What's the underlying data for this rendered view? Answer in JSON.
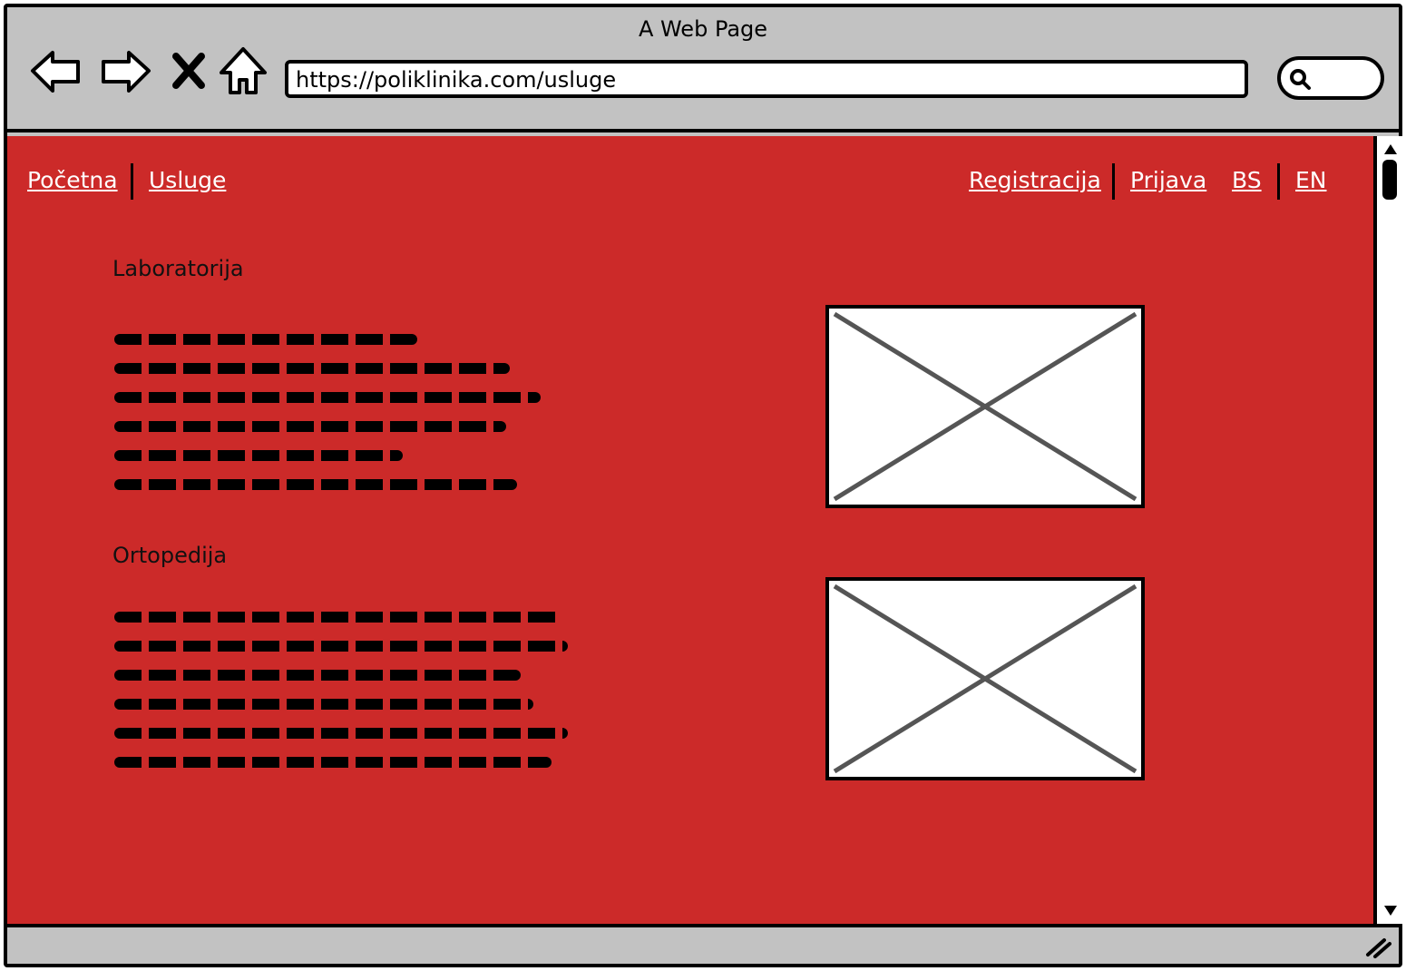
{
  "window": {
    "title": "A Web Page"
  },
  "toolbar": {
    "back_icon": "arrow-left-icon",
    "forward_icon": "arrow-right-icon",
    "stop_icon": "close-icon",
    "home_icon": "home-icon",
    "url": "https://poliklinika.com/usluge",
    "search_icon": "search-icon"
  },
  "nav": {
    "left": [
      {
        "label": "Početna"
      },
      {
        "label": "Usluge"
      }
    ],
    "right": [
      {
        "label": "Registracija"
      },
      {
        "label": "Prijava"
      },
      {
        "label": "BS"
      },
      {
        "label": "EN"
      }
    ]
  },
  "sections": [
    {
      "title": "Laboratorija",
      "image": "image-placeholder"
    },
    {
      "title": "Ortopedija",
      "image": "image-placeholder"
    }
  ],
  "colors": {
    "background": "#cc2a29",
    "chrome": "#c2c2c2",
    "link": "#ffffff"
  }
}
